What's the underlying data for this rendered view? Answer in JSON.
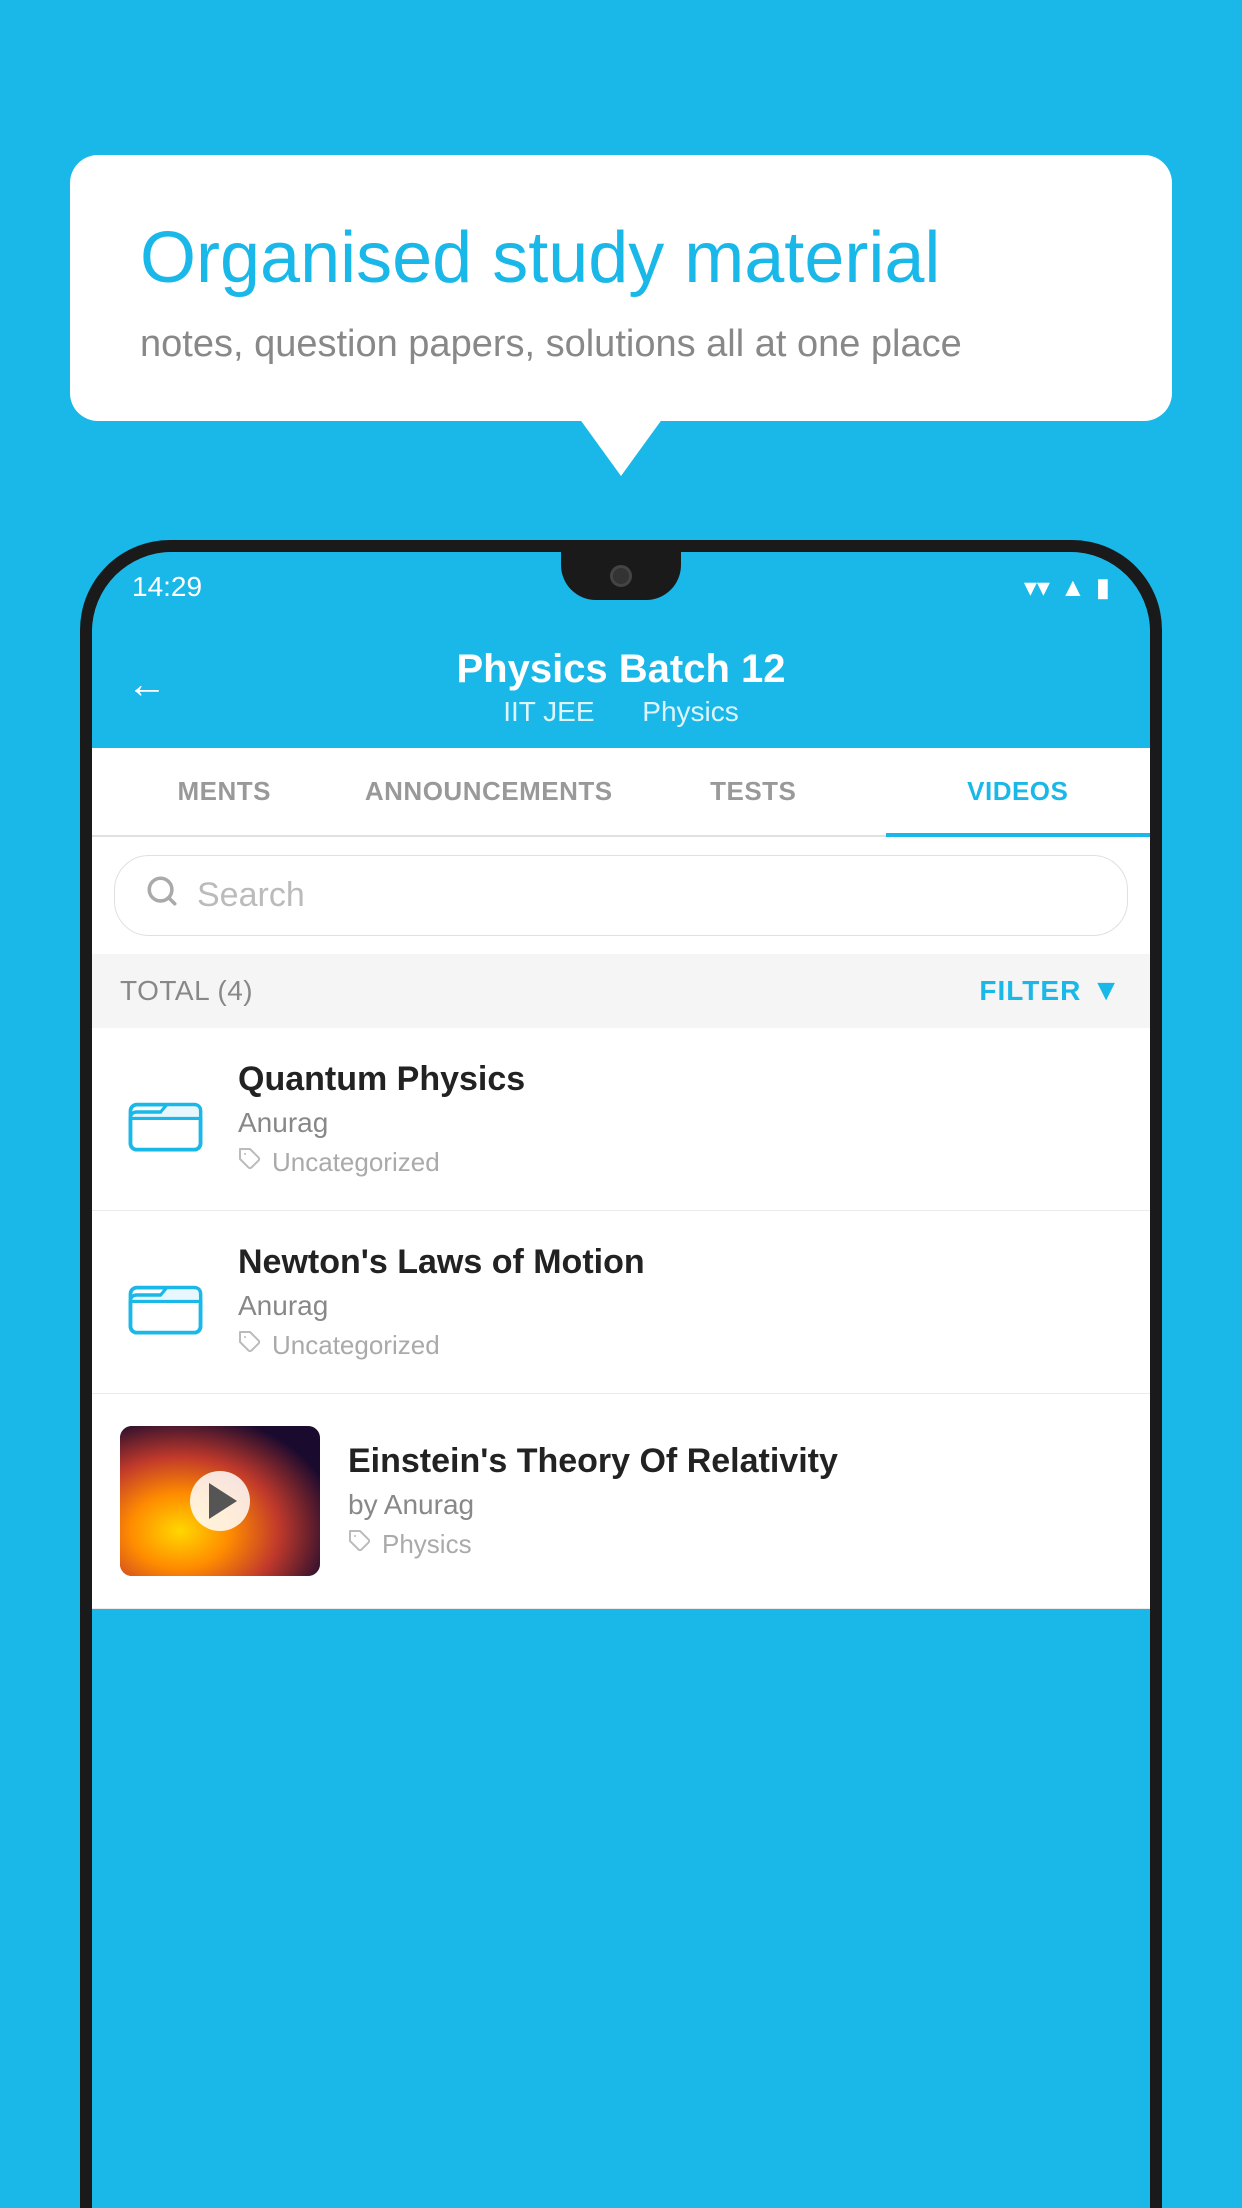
{
  "background_color": "#1ab8e8",
  "speech_bubble": {
    "title": "Organised study material",
    "subtitle": "notes, question papers, solutions all at one place"
  },
  "status_bar": {
    "time": "14:29",
    "icons": [
      "wifi",
      "signal",
      "battery"
    ]
  },
  "app_header": {
    "title": "Physics Batch 12",
    "subtitle_part1": "IIT JEE",
    "subtitle_part2": "Physics",
    "back_label": "←"
  },
  "tabs": [
    {
      "label": "MENTS",
      "active": false
    },
    {
      "label": "ANNOUNCEMENTS",
      "active": false
    },
    {
      "label": "TESTS",
      "active": false
    },
    {
      "label": "VIDEOS",
      "active": true
    }
  ],
  "search": {
    "placeholder": "Search"
  },
  "filter_row": {
    "total_label": "TOTAL (4)",
    "filter_label": "FILTER"
  },
  "videos": [
    {
      "title": "Quantum Physics",
      "author": "Anurag",
      "tag": "Uncategorized",
      "has_thumbnail": false
    },
    {
      "title": "Newton's Laws of Motion",
      "author": "Anurag",
      "tag": "Uncategorized",
      "has_thumbnail": false
    },
    {
      "title": "Einstein's Theory Of Relativity",
      "author": "by Anurag",
      "tag": "Physics",
      "has_thumbnail": true
    }
  ],
  "accent_color": "#1ab8e8",
  "icons": {
    "folder": "folder-icon",
    "tag": "tag-icon",
    "filter": "filter-icon",
    "search": "search-icon",
    "back": "back-icon",
    "play": "play-icon"
  }
}
